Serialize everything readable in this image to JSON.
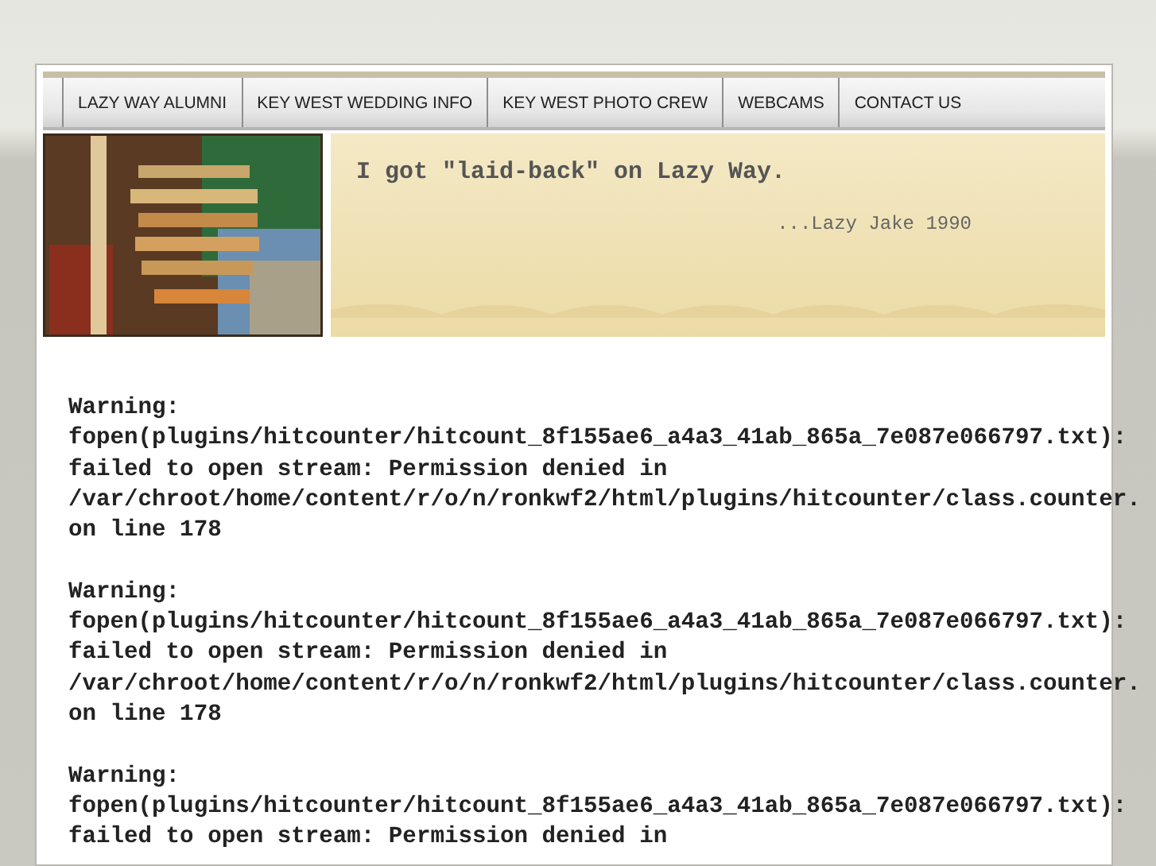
{
  "nav": {
    "items": [
      {
        "label": "LAZY WAY ALUMNI"
      },
      {
        "label": "KEY WEST WEDDING INFO"
      },
      {
        "label": "KEY WEST PHOTO CREW"
      },
      {
        "label": "WEBCAMS"
      },
      {
        "label": "CONTACT US"
      }
    ]
  },
  "header": {
    "quote": "I got \"laid-back\" on Lazy Way.",
    "attribution": "...Lazy Jake 1990"
  },
  "warnings": [
    {
      "lines": [
        "Warning:",
        "fopen(plugins/hitcounter/hitcount_8f155ae6_a4a3_41ab_865a_7e087e066797.txt):",
        "failed to open stream: Permission denied in",
        "/var/chroot/home/content/r/o/n/ronkwf2/html/plugins/hitcounter/class.counter.",
        "on line 178"
      ]
    },
    {
      "lines": [
        "Warning:",
        "fopen(plugins/hitcounter/hitcount_8f155ae6_a4a3_41ab_865a_7e087e066797.txt):",
        "failed to open stream: Permission denied in",
        "/var/chroot/home/content/r/o/n/ronkwf2/html/plugins/hitcounter/class.counter.",
        "on line 178"
      ]
    },
    {
      "lines": [
        "Warning:",
        "fopen(plugins/hitcounter/hitcount_8f155ae6_a4a3_41ab_865a_7e087e066797.txt):",
        "failed to open stream: Permission denied in"
      ]
    }
  ]
}
